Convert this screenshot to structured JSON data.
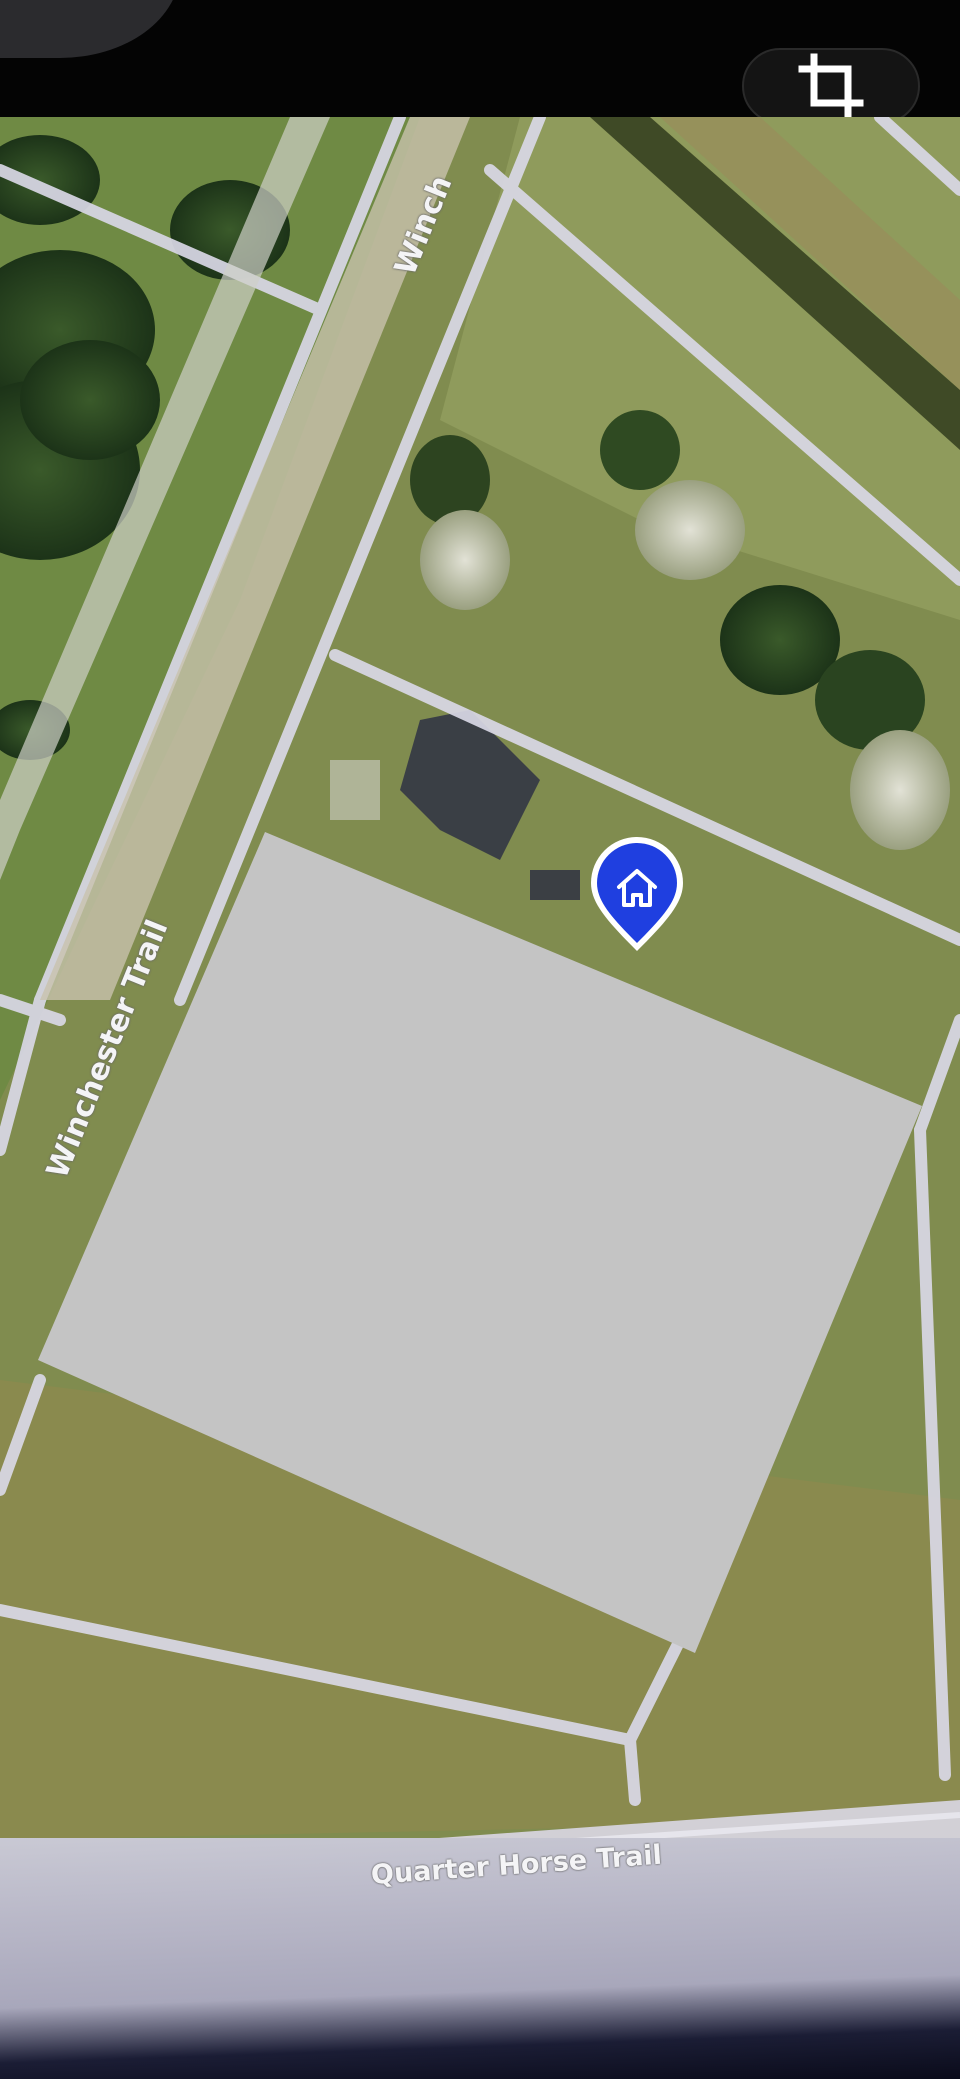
{
  "toolbar": {
    "crop_icon": "crop-icon"
  },
  "map": {
    "view": "satellite",
    "marker_icon": "home-icon",
    "marker_color": "#1f3fe0",
    "redaction_color": "#c4c4c4",
    "road_labels": {
      "winchester_trail": "Winchester Trail",
      "winchester_top": "Winch",
      "quarter_horse_trail": "Quarter Horse Trail"
    }
  }
}
